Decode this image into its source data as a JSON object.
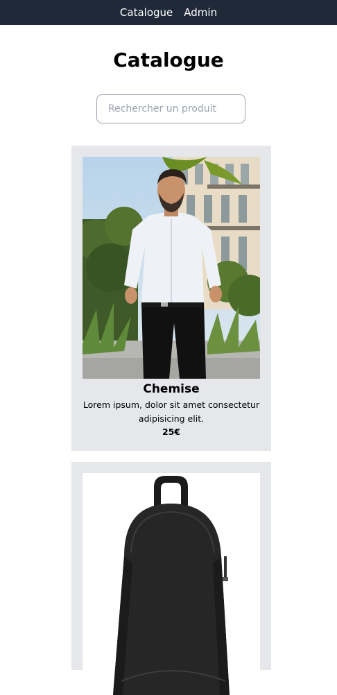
{
  "nav": {
    "items": [
      {
        "label": "Catalogue"
      },
      {
        "label": "Admin"
      }
    ]
  },
  "page": {
    "title": "Catalogue"
  },
  "search": {
    "placeholder": "Rechercher un produit",
    "value": ""
  },
  "products": [
    {
      "name": "Chemise",
      "description": "Lorem ipsum, dolor sit amet consectetur adipisicing elit.",
      "price": "25€",
      "image_icon": "man-in-white-shirt-photo"
    },
    {
      "name": "",
      "description": "",
      "price": "",
      "image_icon": "black-backpack-photo"
    }
  ]
}
